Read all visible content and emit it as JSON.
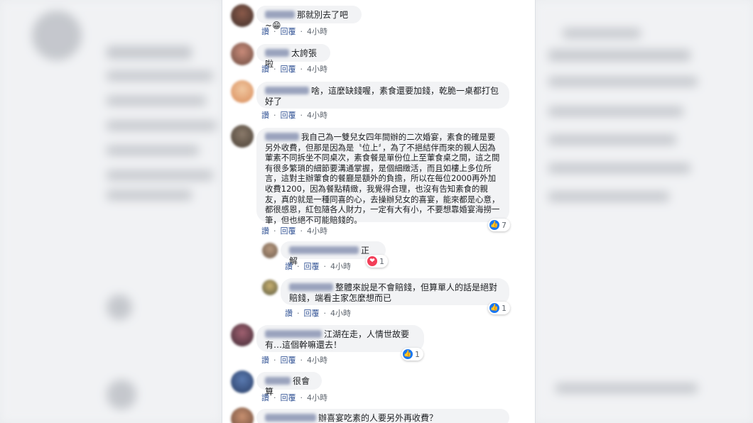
{
  "ui": {
    "reply": "讚",
    "reply_action": "回覆",
    "time": "4小時"
  },
  "comments": [
    {
      "text": "那就別去了吧~😁"
    },
    {
      "text": "太誇張啦"
    },
    {
      "text": "啥，這麼缺錢喔，素食還要加錢，乾脆一桌都打包好了"
    },
    {
      "text": "我自己為一雙兒女四年間辦的二次婚宴，素食的確是要另外收費，但那是因為是〝位上〞，為了不挹結伴而來的親人因為葷素不同拆坐不同桌次，素食餐是單份位上至葷食桌之間，這之間有很多繁瑣的細節要溝通掌握，是個細緻活，而且如樓上多位所言，這對主辦葷食的餐廳是額外的負擔，所以在每位2000再外加收費1200，因為餐點精緻，我覺得合理，也沒有告知素食的親友，真的就是一種同喜的心，去操辦兒女的喜宴，能來都是心意，都很感恩，紅包隨各人財力，一定有大有小，不要想靠婚宴海撈一筆，但也絕不可能賠錢的。",
      "reaction_count": "7"
    },
    {
      "text": "正解",
      "reaction_count": "1"
    },
    {
      "text": "整體來說是不會賠錢，但算單人的話是絕對賠錢，端看主家怎麼想而已",
      "reaction_count": "1"
    },
    {
      "text": "江湖在走，人情世故要有…這個幹嘛還去！",
      "reaction_count": "1"
    },
    {
      "text": "很會算"
    },
    {
      "text": "辦喜宴吃素的人要另外再收費？"
    }
  ]
}
